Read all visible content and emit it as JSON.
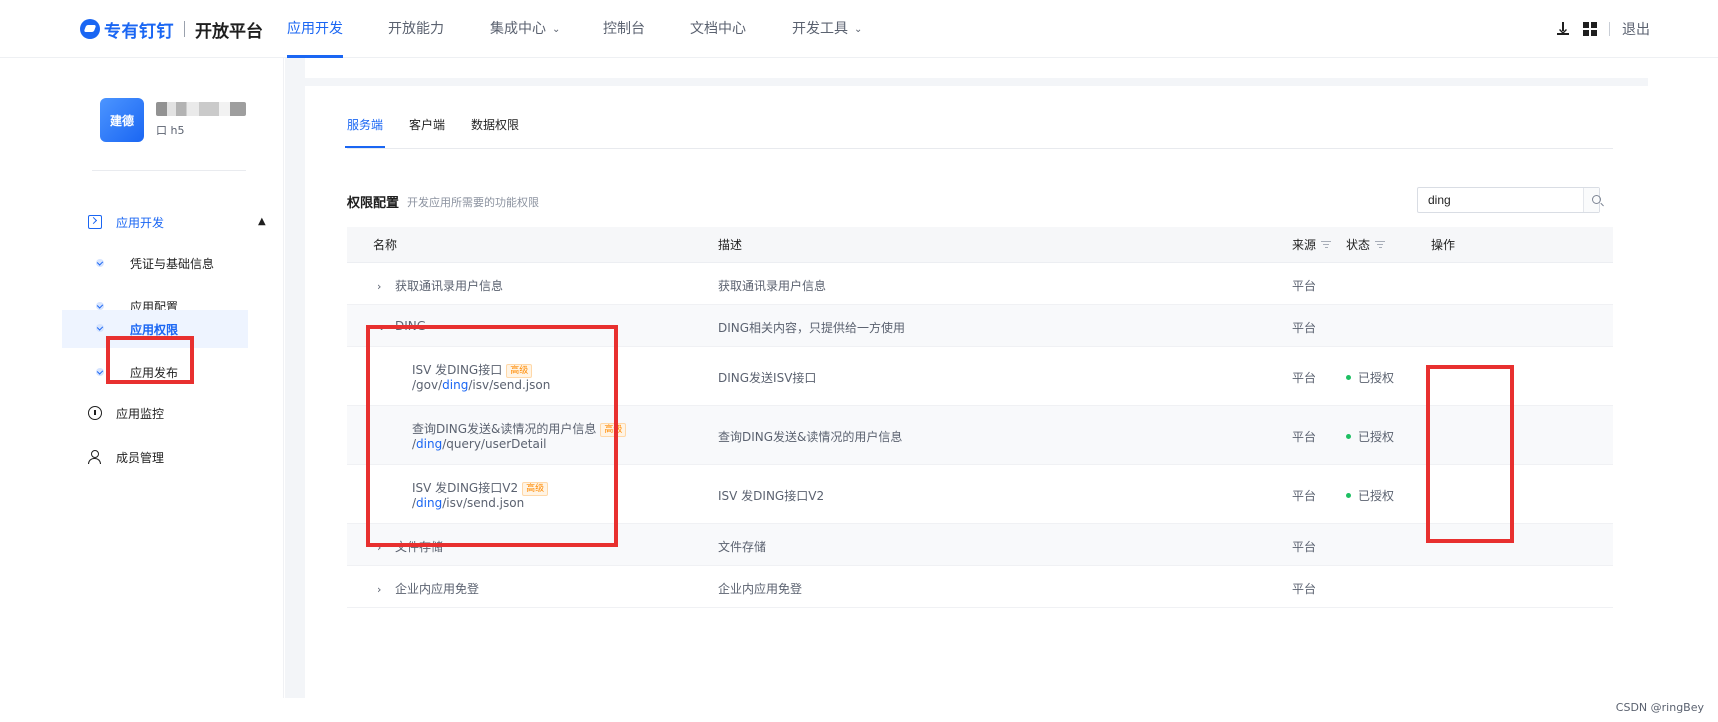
{
  "brand": {
    "name": "专有钉钉",
    "product": "开放平台"
  },
  "nav": {
    "items": [
      {
        "label": "应用开发"
      },
      {
        "label": "开放能力"
      },
      {
        "label": "集成中心"
      },
      {
        "label": "控制台"
      },
      {
        "label": "文档中心"
      },
      {
        "label": "开发工具"
      }
    ],
    "logout": "退出"
  },
  "sidebar": {
    "app": {
      "avatar_text": "建德",
      "sub": "口 h5"
    },
    "group_dev": "应用开发",
    "items": [
      {
        "label": "凭证与基础信息"
      },
      {
        "label": "应用配置"
      },
      {
        "label": "应用权限"
      },
      {
        "label": "应用发布"
      }
    ],
    "group_monitor": "应用监控",
    "group_members": "成员管理"
  },
  "tabs": [
    {
      "label": "服务端"
    },
    {
      "label": "客户端"
    },
    {
      "label": "数据权限"
    }
  ],
  "section": {
    "title": "权限配置",
    "desc": "开发应用所需要的功能权限"
  },
  "search": {
    "value": "ding"
  },
  "table": {
    "headers": {
      "name": "名称",
      "desc": "描述",
      "source": "来源",
      "status": "状态",
      "action": "操作"
    },
    "rows": [
      {
        "name": "获取通讯录用户信息",
        "desc": "获取通讯录用户信息",
        "source": "平台"
      },
      {
        "name": "DING",
        "desc": "DING相关内容，只提供给一方使用",
        "source": "平台"
      },
      {
        "name": "ISV 发DING接口",
        "tag": "高级",
        "path_pre": "/gov/",
        "path_hl": "ding",
        "path_post": "/isv/send.json",
        "desc": "DING发送ISV接口",
        "source": "平台",
        "status": "已授权"
      },
      {
        "name": "查询DING发送&读情况的用户信息",
        "tag": "高级",
        "path_pre": "/",
        "path_hl": "ding",
        "path_post": "/query/userDetail",
        "desc": "查询DING发送&读情况的用户信息",
        "source": "平台",
        "status": "已授权"
      },
      {
        "name": "ISV 发DING接口V2",
        "tag": "高级",
        "path_pre": "/",
        "path_hl": "ding",
        "path_post": "/isv/send.json",
        "desc": "ISV 发DING接口V2",
        "source": "平台",
        "status": "已授权"
      },
      {
        "name": "文件存储",
        "desc": "文件存储",
        "source": "平台"
      },
      {
        "name": "企业内应用免登",
        "desc": "企业内应用免登",
        "source": "平台"
      }
    ]
  },
  "watermark": "CSDN @ringBey",
  "colors": {
    "accent": "#1a66f3",
    "annotation": "#e8302f",
    "authorized": "#1dbf62",
    "tag": "#ff8a00"
  }
}
